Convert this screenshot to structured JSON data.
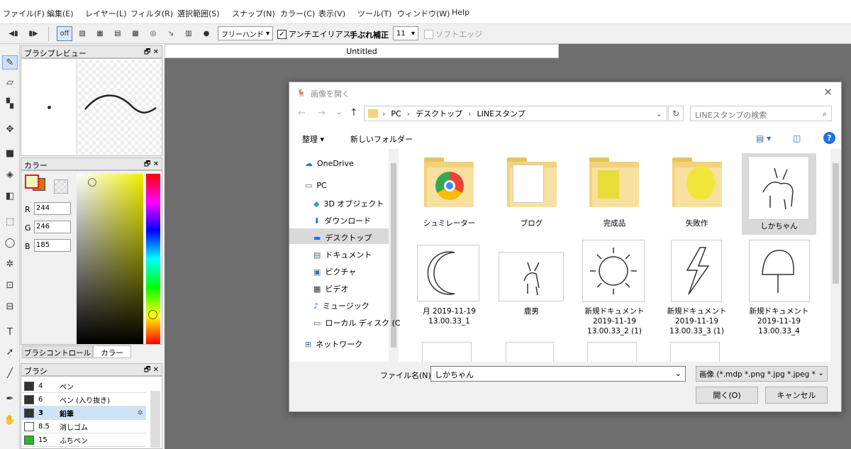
{
  "menu": {
    "items": [
      "ファイル(F)",
      "編集(E)",
      "レイヤー(L)",
      "フィルタ(R)",
      "選択範囲(S)",
      "スナップ(N)",
      "カラー(C)",
      "表示(V)",
      "ツール(T)",
      "ウィンドウ(W)",
      "Help"
    ]
  },
  "toolbar": {
    "off_label": "off",
    "stroke_mode": "フリーハンド",
    "antialias_label": "アンチエイリアス",
    "antialias_checked": true,
    "stabilizer_label": "手ぶれ補正",
    "stabilizer_value": "11",
    "soft_edge_label": "ソフトエッジ"
  },
  "brush_preview": {
    "title": "ブラシプレビュー"
  },
  "color_panel": {
    "title": "カラー",
    "r_label": "R",
    "r": "244",
    "g_label": "G",
    "g": "246",
    "b_label": "B",
    "b": "185",
    "tab1": "ブラシコントロール",
    "tab2": "カラー"
  },
  "brush_panel": {
    "title": "ブラシ",
    "items": [
      {
        "size": "4",
        "name": "ペン",
        "color": "#333333"
      },
      {
        "size": "6",
        "name": "ペン (入り抜き)",
        "color": "#333333"
      },
      {
        "size": "3",
        "name": "鉛筆",
        "color": "#333333",
        "selected": true
      },
      {
        "size": "8.5",
        "name": "消しゴム",
        "color": "#ffffff"
      },
      {
        "size": "15",
        "name": "ふちペン",
        "color": "#2bb52b"
      }
    ]
  },
  "document": {
    "tab_title": "Untitled"
  },
  "dialog": {
    "title": "画像を開く",
    "breadcrumb": [
      "PC",
      "デスクトップ",
      "LINEスタンプ"
    ],
    "search_placeholder": "LINEスタンプの検索",
    "organize_label": "整理 ▾",
    "new_folder_label": "新しいフォルダー",
    "nav": [
      {
        "label": "OneDrive",
        "icon": "cloud-icon"
      },
      {
        "label": "PC",
        "icon": "computer-icon"
      },
      {
        "label": "3D オブジェクト",
        "icon": "cube-icon"
      },
      {
        "label": "ダウンロード",
        "icon": "download-icon"
      },
      {
        "label": "デスクトップ",
        "icon": "desktop-icon",
        "selected": true
      },
      {
        "label": "ドキュメント",
        "icon": "document-icon"
      },
      {
        "label": "ピクチャ",
        "icon": "picture-icon"
      },
      {
        "label": "ビデオ",
        "icon": "video-icon"
      },
      {
        "label": "ミュージック",
        "icon": "music-icon"
      },
      {
        "label": "ローカル ディスク (C",
        "icon": "disk-icon"
      },
      {
        "label": "ネットワーク",
        "icon": "network-icon"
      }
    ],
    "files": [
      {
        "name": "シュミレーター",
        "kind": "folder"
      },
      {
        "name": "ブログ",
        "kind": "folder"
      },
      {
        "name": "完成品",
        "kind": "folder"
      },
      {
        "name": "失敗作",
        "kind": "folder"
      },
      {
        "name": "しかちゃん",
        "kind": "image",
        "selected": true
      },
      {
        "name": "月 2019-11-19 13.00.33_1",
        "kind": "image"
      },
      {
        "name": "鹿男",
        "kind": "image"
      },
      {
        "name": "新規ドキュメント 2019-11-19 13.00.33_2 (1)",
        "kind": "image"
      },
      {
        "name": "新規ドキュメント 2019-11-19 13.00.33_3 (1)",
        "kind": "image"
      },
      {
        "name": "新規ドキュメント 2019-11-19 13.00.33_4",
        "kind": "image"
      }
    ],
    "filename_label": "ファイル名(N):",
    "filename_value": "しかちゃん",
    "filetype_value": "画像 (*.mdp *.png *.jpg *.jpeg *",
    "open_label": "開く(O)",
    "cancel_label": "キャンセル"
  }
}
